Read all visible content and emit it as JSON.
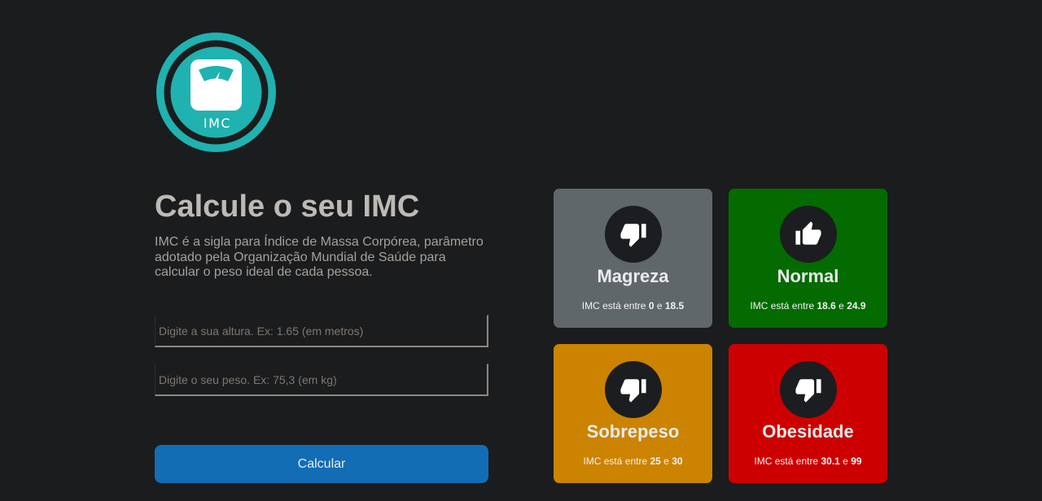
{
  "logo": {
    "text": "IMC",
    "icon": "scale-icon",
    "color": "#1fb2b0"
  },
  "header": {
    "title": "Calcule o seu IMC",
    "description": "IMC é a sigla para Índice de Massa Corpórea, parâmetro adotado pela Organização Mundial de Saúde para calcular o peso ideal de cada pessoa."
  },
  "form": {
    "height": {
      "value": "",
      "placeholder": "Digite a sua altura. Ex: 1.65 (em metros)"
    },
    "weight": {
      "value": "",
      "placeholder": "Digite o seu peso. Ex: 75,3 (em kg)"
    },
    "submit_label": "Calcular"
  },
  "categories": [
    {
      "name": "Magreza",
      "prefix": "IMC está entre",
      "min": "0",
      "joiner": "e",
      "max": "18.5",
      "icon": "thumbs-down-icon",
      "color": "#60676b"
    },
    {
      "name": "Normal",
      "prefix": "IMC está entre",
      "min": "18.6",
      "joiner": "e",
      "max": "24.9",
      "icon": "thumbs-up-icon",
      "color": "#036b00"
    },
    {
      "name": "Sobrepeso",
      "prefix": "IMC está entre",
      "min": "25",
      "joiner": "e",
      "max": "30",
      "icon": "thumbs-down-icon",
      "color": "#cc8300"
    },
    {
      "name": "Obesidade",
      "prefix": "IMC está entre",
      "min": "30.1",
      "joiner": "e",
      "max": "99",
      "icon": "thumbs-down-icon",
      "color": "#cc0000"
    }
  ]
}
